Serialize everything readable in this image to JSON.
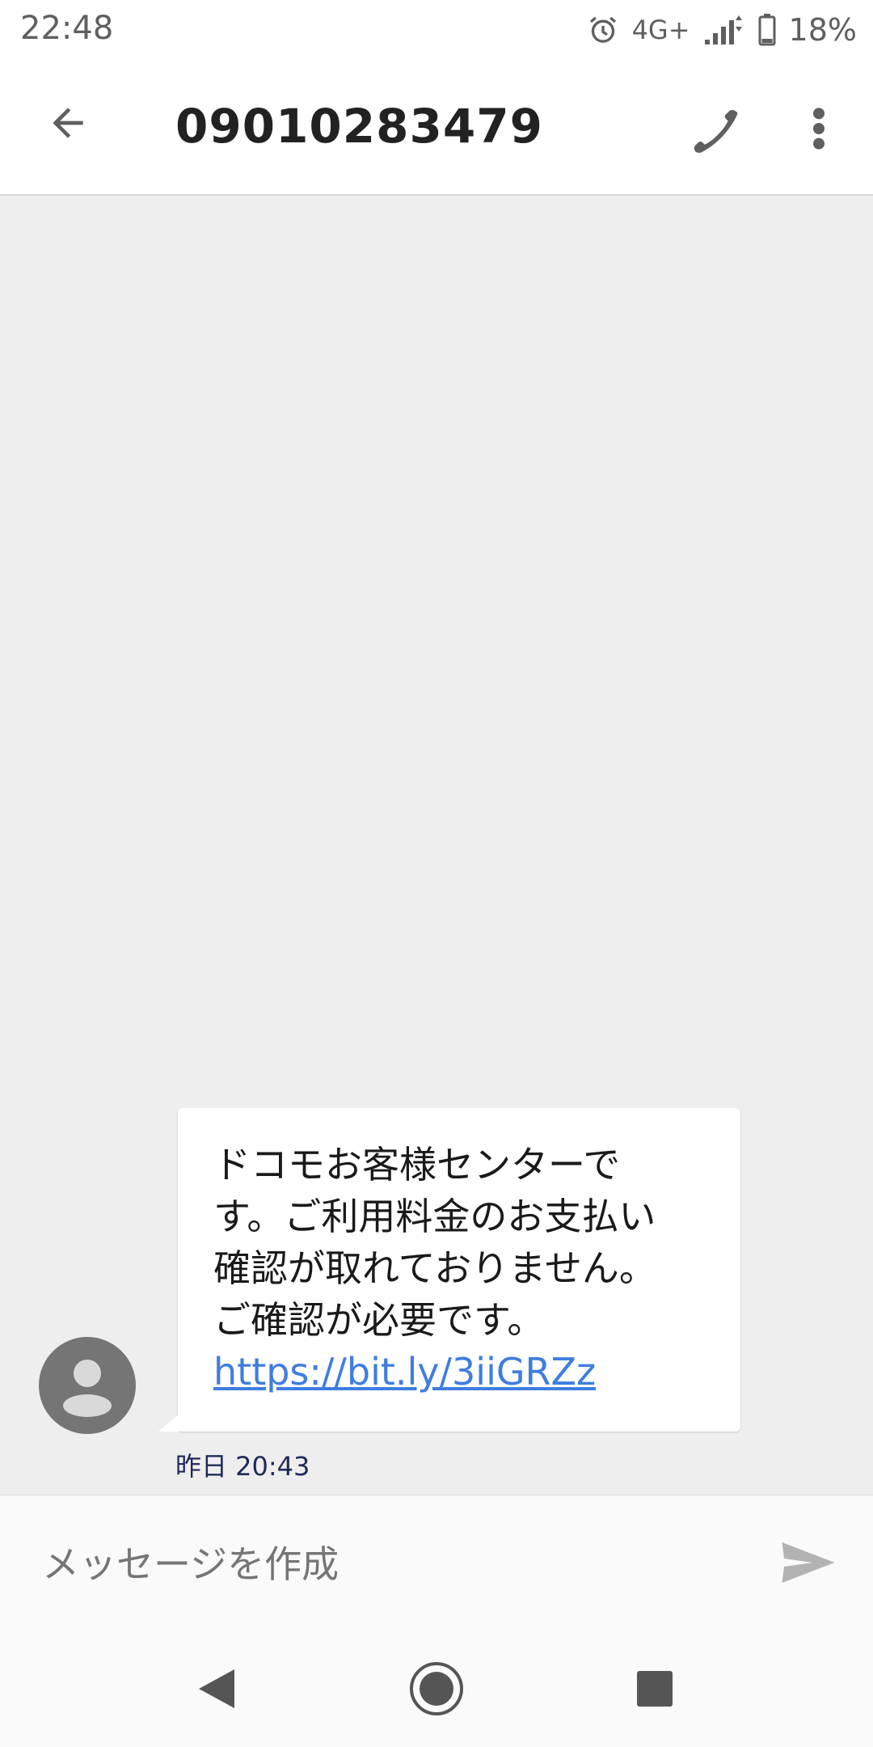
{
  "status": {
    "time": "22:48",
    "network": "4G+",
    "battery": "18%",
    "icons": [
      "alarm-icon",
      "signal-icon",
      "battery-icon"
    ]
  },
  "header": {
    "title": "09010283479",
    "icons": [
      "back-arrow-icon",
      "phone-icon",
      "more-vert-icon"
    ]
  },
  "message": {
    "text": "ドコモお客様センターです。ご利用料金のお支払い確認が取れておりません。ご確認が必要です。",
    "link": "https://bit.ly/3iiGRZz",
    "timestamp": "昨日 20:43"
  },
  "composer": {
    "placeholder": "メッセージを作成",
    "icons": [
      "send-icon"
    ]
  },
  "navbar": {
    "icons": [
      "nav-back-icon",
      "nav-home-icon",
      "nav-recents-icon"
    ]
  },
  "colors": {
    "link": "#3f7de0",
    "avatar": "#757575",
    "background": "#eeeeee",
    "timestamp": "#1e2a5a"
  }
}
